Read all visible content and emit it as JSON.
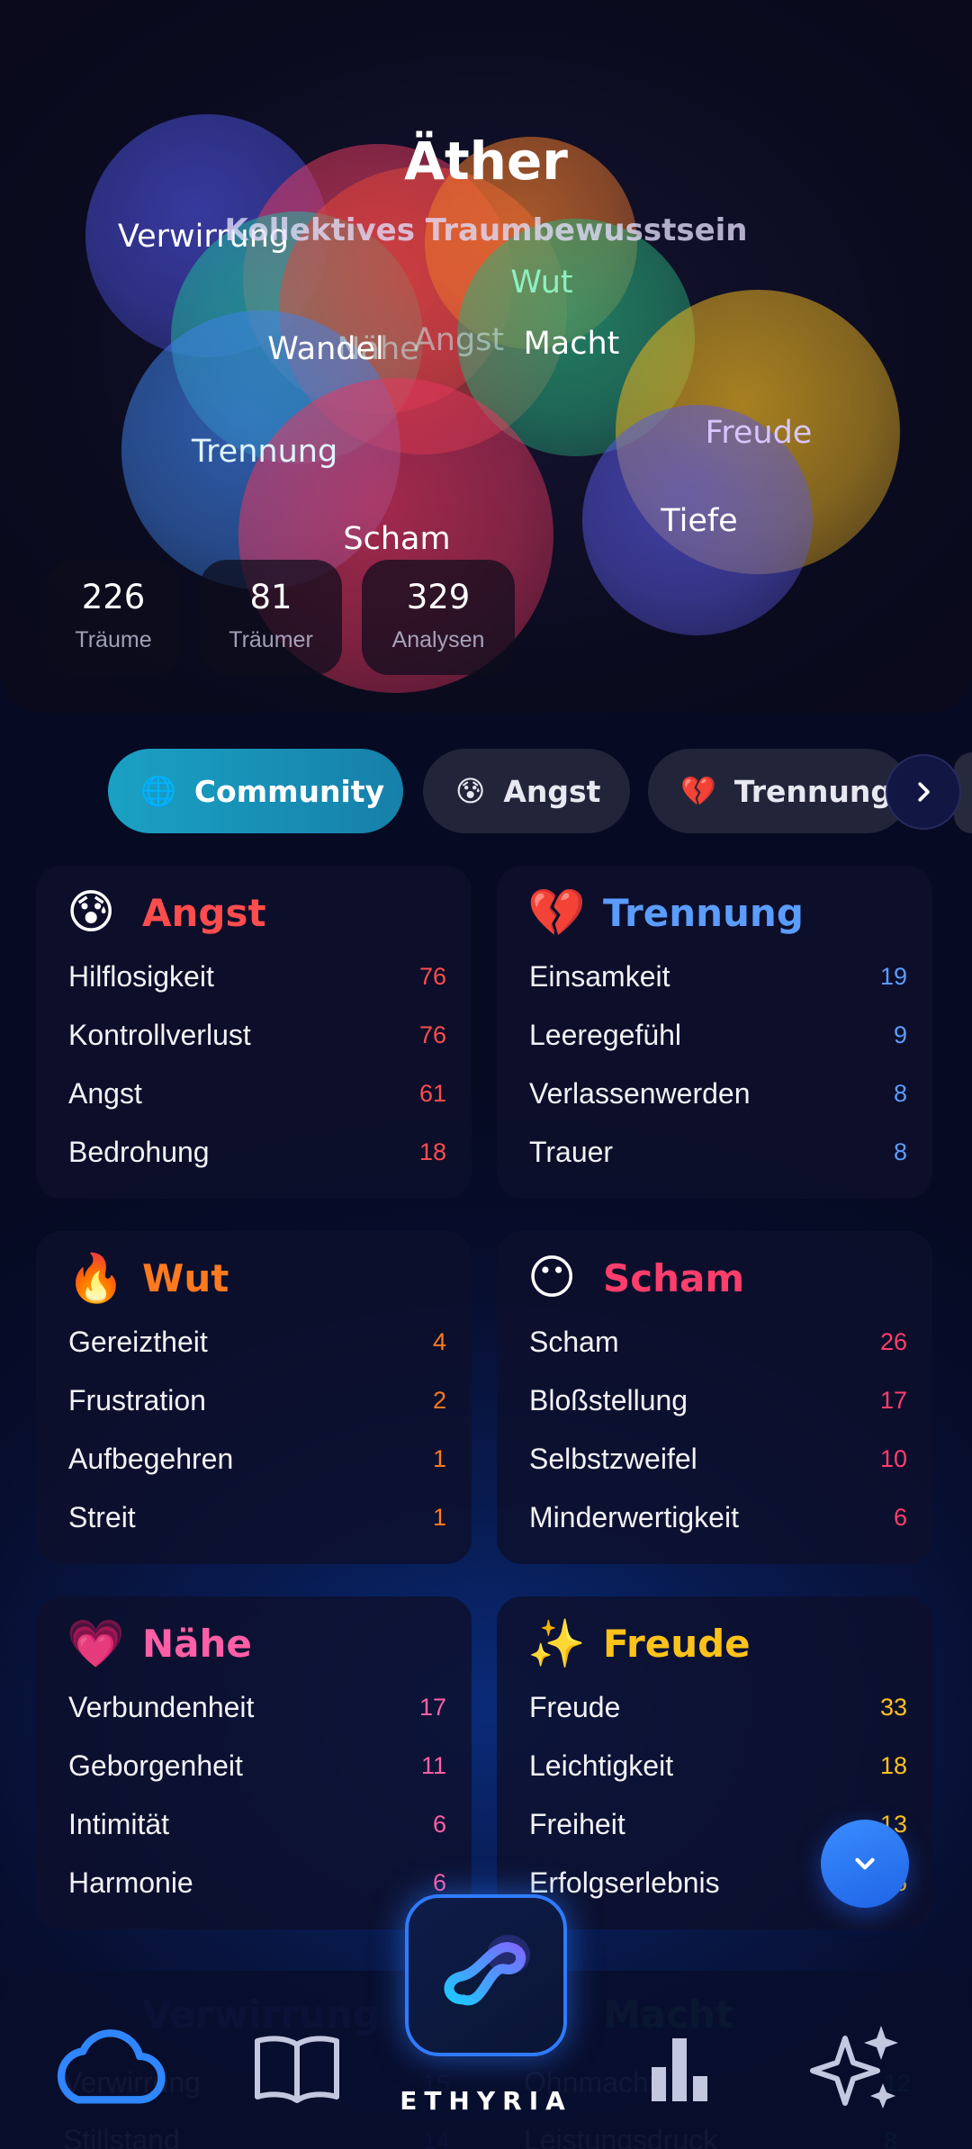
{
  "hero": {
    "title": "Äther",
    "subtitle": "Kollektives Traumbewusstsein",
    "bubbles": [
      {
        "label": "Verwirrung",
        "color": "#4b4fd8"
      },
      {
        "label": "Nähe",
        "color": "#e23a5e"
      },
      {
        "label": "Wandel",
        "color": "#1fb89a"
      },
      {
        "label": "Angst",
        "color": "#e2463a"
      },
      {
        "label": "Wut",
        "color": "#f07a2a"
      },
      {
        "label": "Macht",
        "color": "#2ab07a"
      },
      {
        "label": "Trennung",
        "color": "#3f82e8"
      },
      {
        "label": "Freude",
        "color": "#f0b61e"
      },
      {
        "label": "Tiefe",
        "color": "#5a58e0"
      },
      {
        "label": "Scham",
        "color": "#e8365e"
      }
    ],
    "stats": [
      {
        "value": "226",
        "label": "Träume"
      },
      {
        "value": "81",
        "label": "Träumer"
      },
      {
        "value": "329",
        "label": "Analysen"
      }
    ]
  },
  "filters": {
    "chips": [
      {
        "icon": "🌐",
        "label": "Community",
        "active": true
      },
      {
        "icon": "😰",
        "label": "Angst",
        "active": false
      },
      {
        "icon": "💔",
        "label": "Trennung",
        "active": false
      }
    ],
    "next_icon": "chevron-right-icon"
  },
  "categories": [
    {
      "emoji": "😰",
      "title": "Angst",
      "color": "#ff4d4d",
      "items": [
        {
          "term": "Hilflosigkeit",
          "count": "76"
        },
        {
          "term": "Kontrollverlust",
          "count": "76"
        },
        {
          "term": "Angst",
          "count": "61"
        },
        {
          "term": "Bedrohung",
          "count": "18"
        }
      ]
    },
    {
      "emoji": "💔",
      "title": "Trennung",
      "color": "#5b9cff",
      "items": [
        {
          "term": "Einsamkeit",
          "count": "19"
        },
        {
          "term": "Leeregefühl",
          "count": "9"
        },
        {
          "term": "Verlassenwerden",
          "count": "8"
        },
        {
          "term": "Trauer",
          "count": "8"
        }
      ]
    },
    {
      "emoji": "🔥",
      "title": "Wut",
      "color": "#ff7a1f",
      "items": [
        {
          "term": "Gereiztheit",
          "count": "4"
        },
        {
          "term": "Frustration",
          "count": "2"
        },
        {
          "term": "Aufbegehren",
          "count": "1"
        },
        {
          "term": "Streit",
          "count": "1"
        }
      ]
    },
    {
      "emoji": "😶",
      "title": "Scham",
      "color": "#ff3e6c",
      "items": [
        {
          "term": "Scham",
          "count": "26"
        },
        {
          "term": "Bloßstellung",
          "count": "17"
        },
        {
          "term": "Selbstzweifel",
          "count": "10"
        },
        {
          "term": "Minderwertigkeit",
          "count": "6"
        }
      ]
    },
    {
      "emoji": "💗",
      "title": "Nähe",
      "color": "#ff5fa6",
      "items": [
        {
          "term": "Verbundenheit",
          "count": "17"
        },
        {
          "term": "Geborgenheit",
          "count": "11"
        },
        {
          "term": "Intimität",
          "count": "6"
        },
        {
          "term": "Harmonie",
          "count": "6"
        }
      ]
    },
    {
      "emoji": "✨",
      "title": "Freude",
      "color": "#ffc21a",
      "items": [
        {
          "term": "Freude",
          "count": "33"
        },
        {
          "term": "Leichtigkeit",
          "count": "18"
        },
        {
          "term": "Freiheit",
          "count": "13"
        },
        {
          "term": "Erfolgserlebnis",
          "count": "6"
        }
      ]
    }
  ],
  "partial": [
    {
      "title": "Verwirrung",
      "color": "#5860e8",
      "items": [
        "Verwirrung",
        "Stillstand"
      ],
      "counts": [
        "15",
        "14"
      ]
    },
    {
      "title": "Macht",
      "color": "#22c07a",
      "items": [
        "Ohnmacht",
        "Leistungsdruck"
      ],
      "counts": [
        "12",
        "8"
      ]
    }
  ],
  "nav": {
    "brand": "ETHYRIA",
    "items": [
      {
        "icon": "cloud-icon"
      },
      {
        "icon": "book-icon"
      },
      {
        "icon": "infinity-icon"
      },
      {
        "icon": "bar-chart-icon"
      },
      {
        "icon": "sparkles-icon"
      }
    ]
  },
  "fab_icon": "chevron-down-icon"
}
